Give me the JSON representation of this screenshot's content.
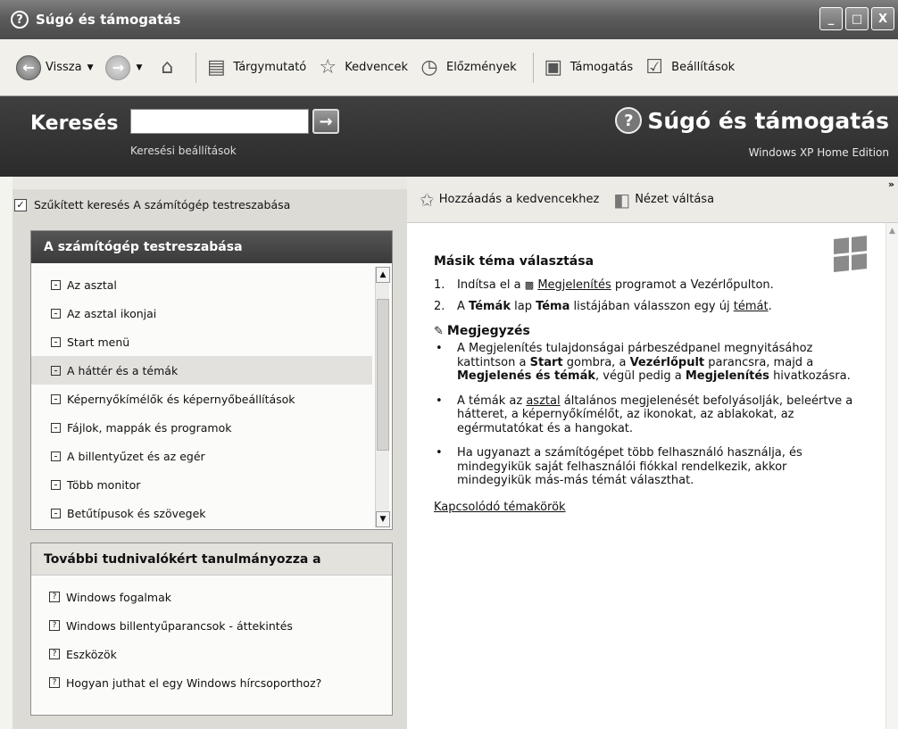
{
  "window": {
    "title": "Súgó és támogatás",
    "controls": [
      "_",
      "□",
      "X"
    ]
  },
  "toolbar": {
    "back_label": "Vissza",
    "index_label": "Tárgymutató",
    "favorites_label": "Kedvencek",
    "history_label": "Előzmények",
    "support_label": "Támogatás",
    "options_label": "Beállítások"
  },
  "search": {
    "label": "Keresés",
    "placeholder": "",
    "go_icon": "arrow-right-icon",
    "options_label": "Keresési beállítások"
  },
  "brand": {
    "title": "Súgó és támogatás",
    "edition": "Windows XP Home Edition"
  },
  "scope": {
    "checked": true,
    "label": "Szűkített keresés A számítógép testreszabása"
  },
  "customize_panel": {
    "header": "A számítógép testreszabása",
    "items": [
      {
        "label": "Az asztal"
      },
      {
        "label": "Az asztal ikonjai"
      },
      {
        "label": "Start menü"
      },
      {
        "label": "A háttér és a témák",
        "active": true
      },
      {
        "label": "Képernyőkímélők és képernyőbeállítások"
      },
      {
        "label": "Fájlok, mappák és programok"
      },
      {
        "label": "A billentyűzet és az egér"
      },
      {
        "label": "Több monitor"
      },
      {
        "label": "Betűtípusok és szövegek"
      }
    ]
  },
  "learn_panel": {
    "header": "További tudnivalókért tanulmányozza a",
    "items": [
      {
        "label": "Windows fogalmak"
      },
      {
        "label": "Windows billentyűparancsok - áttekintés"
      },
      {
        "label": "Eszközök"
      },
      {
        "label": "Hogyan juthat el egy Windows hírcsoporthoz?"
      }
    ]
  },
  "right_toolbar": {
    "add_favorites_label": "Hozzáadás a kedvencekhez",
    "change_view_label": "Nézet váltása",
    "more": "»"
  },
  "article": {
    "title": "Másik téma választása",
    "step1_num": "1.",
    "step1_pre": "Indítsa el a",
    "step1_link": "Megjelenítés",
    "step1_post": "programot a Vezérlőpulton.",
    "step2_num": "2.",
    "step2_pre": "A",
    "step2_b1": "Témák",
    "step2_mid": "lap",
    "step2_b2": "Téma",
    "step2_post": "listájában válasszon egy új",
    "step2_link": "témát",
    "step2_end": ".",
    "note_title": "Megjegyzés",
    "b1_t1": "A Megjelenítés tulajdonságai párbeszédpanel megnyitásához kattintson a",
    "b1_s1": "Start",
    "b1_t2": "gombra, a",
    "b1_s2": "Vezérlőpult",
    "b1_t3": "parancsra, majd a",
    "b1_s3": "Megjelenés és témák",
    "b1_t4": ", végül pedig a",
    "b1_s4": "Megjelenítés",
    "b1_t5": "hivatkozásra.",
    "b2_t1": "A témák az",
    "b2_link": "asztal",
    "b2_t2": "általános megjelenését befolyásolják, beleértve a hátteret, a képernyőkímélőt, az ikonokat, az ablakokat, az egérmutatókat és a hangokat.",
    "b3": "Ha ugyanazt a számítógépet több felhasználó használja, és mindegyikük saját felhasználói fiókkal rendelkezik, akkor mindegyikük más-más témát választhat.",
    "related": "Kapcsolódó témakörök"
  }
}
